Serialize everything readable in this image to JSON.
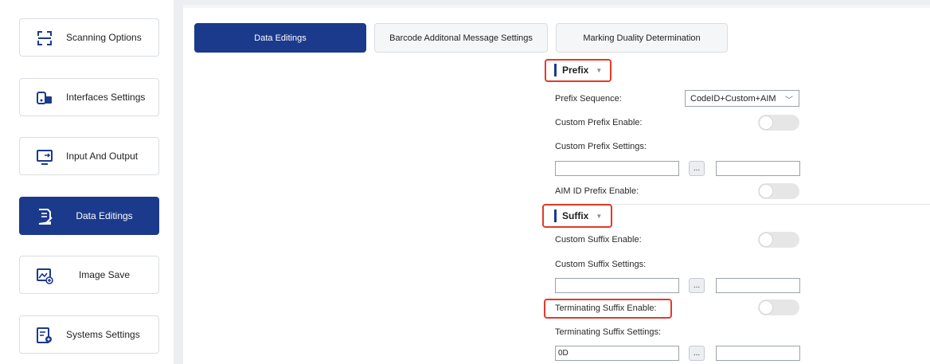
{
  "sidebar": {
    "items": [
      {
        "label": "Scanning Options",
        "icon": "scan-icon",
        "active": false
      },
      {
        "label": "Interfaces Settings",
        "icon": "interfaces-icon",
        "active": false
      },
      {
        "label": "Input And Output",
        "icon": "monitor-io-icon",
        "active": false
      },
      {
        "label": "Data Editings",
        "icon": "document-edit-icon",
        "active": true
      },
      {
        "label": "Image Save",
        "icon": "image-save-icon",
        "active": false
      },
      {
        "label": "Systems Settings",
        "icon": "system-settings-icon",
        "active": false
      }
    ]
  },
  "tabs": [
    {
      "label": "Data Editings",
      "active": true
    },
    {
      "label": "Barcode Additonal Message Settings",
      "active": false
    },
    {
      "label": "Marking Duality Determination",
      "active": false
    }
  ],
  "prefix": {
    "title": "Prefix",
    "sequence_label": "Prefix Sequence:",
    "sequence_value": "CodeID+Custom+AIM",
    "custom_enable_label": "Custom Prefix Enable:",
    "custom_settings_label": "Custom Prefix Settings:",
    "custom_value_1": "",
    "custom_value_2": "",
    "dots": "...",
    "aim_enable_label": "AIM ID Prefix Enable:"
  },
  "suffix": {
    "title": "Suffix",
    "custom_enable_label": "Custom Suffix Enable:",
    "custom_settings_label": "Custom Suffix Settings:",
    "custom_value_1": "",
    "custom_value_2": "",
    "dots": "...",
    "terminating_enable_label": "Terminating  Suffix Enable:",
    "terminating_settings_label": "Terminating  Suffix Settings:",
    "terminating_value_1": "0D",
    "terminating_value_2": ""
  },
  "colors": {
    "accent": "#1b3a8c",
    "highlight": "#e23a2a"
  }
}
